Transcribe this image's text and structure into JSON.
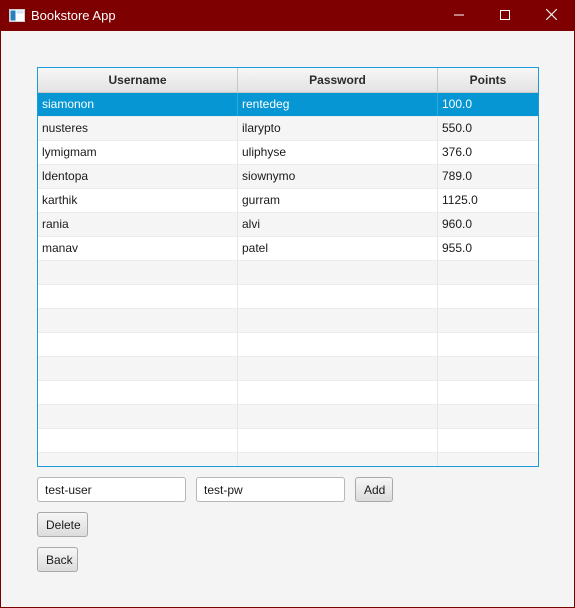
{
  "window": {
    "title": "Bookstore App",
    "titlebar_color": "#7f0000"
  },
  "table": {
    "columns": [
      "Username",
      "Password",
      "Points"
    ],
    "selected_color": "#0596d3",
    "rows": [
      {
        "username": "siamonon",
        "password": "rentedeg",
        "points": "100.0",
        "selected": true
      },
      {
        "username": "nusteres",
        "password": "ilarypto",
        "points": "550.0",
        "selected": false
      },
      {
        "username": "lymigmam",
        "password": "uliphyse",
        "points": "376.0",
        "selected": false
      },
      {
        "username": "ldentopa",
        "password": "siownymo",
        "points": "789.0",
        "selected": false
      },
      {
        "username": "karthik",
        "password": "gurram",
        "points": "1125.0",
        "selected": false
      },
      {
        "username": "rania",
        "password": "alvi",
        "points": "960.0",
        "selected": false
      },
      {
        "username": "manav",
        "password": "patel",
        "points": "955.0",
        "selected": false
      }
    ]
  },
  "form": {
    "username_value": "test-user",
    "password_value": "test-pw",
    "add_label": "Add",
    "delete_label": "Delete",
    "back_label": "Back"
  },
  "icons": {
    "app": "app-window-icon",
    "minimize": "minimize-icon",
    "maximize": "maximize-icon",
    "close": "close-icon"
  }
}
